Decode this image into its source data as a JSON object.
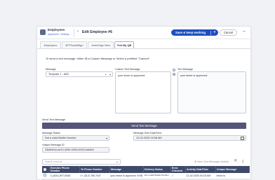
{
  "header": {
    "app_title": "Employees",
    "crumb_1": "Applicants",
    "crumb_sep": "/",
    "crumb_2": "Settings",
    "back_chevron": "‹",
    "page_title": "Edit Employee #6",
    "save_label": "Save & keep working",
    "save_caret": "▾",
    "cancel_label": "Cancel",
    "next_arrow": "→"
  },
  "tabs": [
    {
      "label": "Employees",
      "active": false
    },
    {
      "label": "$TPSocialSign",
      "active": false
    },
    {
      "label": "JuneeSign View",
      "active": false
    },
    {
      "label": "Text My QB",
      "active": true
    }
  ],
  "form": {
    "intro": "To send a text message, either fill a Custom Message or Select a prefilled \"Canned\"",
    "message_label": "Message",
    "message_value": "Template 1 - ABC",
    "clear_icon": "×",
    "dropdown_icon": "▾",
    "custom_label": "Custom Text Message",
    "custom_value": "your leave is approved.",
    "text_message_label": "Text Message",
    "text_message_value": "your leave is approved."
  },
  "send": {
    "section_label": "Send Text Message",
    "button_label": "Send Text Message",
    "status_label": "Message Status",
    "status_value": "Not a valid Mobile Number",
    "date_label": "Message Sent Date/Time",
    "date_value": "12-02-2025 04:58 AM",
    "uid_label": "Unique Message ID",
    "uid_value": "23b8041b-ba70-4290-0000-000112ab301"
  },
  "activity": {
    "search_placeholder": "Search records",
    "search_icon": "⌕",
    "new_label": "New Text Message Activity",
    "new_icon": "⊕",
    "export_icon": "⇱",
    "download_icon": "⤓",
    "columns": [
      "",
      "Exendex Phone Number",
      "To Phone Number",
      "Message",
      "Delivery Status",
      "Error Checked",
      "Activity Date/Time",
      "Unique Message"
    ],
    "rows": [
      {
        "from": "1) (631) 807-8345",
        "to": "1+ (312) 780-7447",
        "message": "your leave is approved. KHB",
        "status": "Not a valid Mobile Number",
        "error": "✓",
        "datetime": "12-02-2025 04:15 AM",
        "uid": "Inbox to"
      }
    ]
  },
  "colors": {
    "primary": "#1e4fbf",
    "send_button": "#55557a",
    "table_header": "#3f4a6b"
  }
}
